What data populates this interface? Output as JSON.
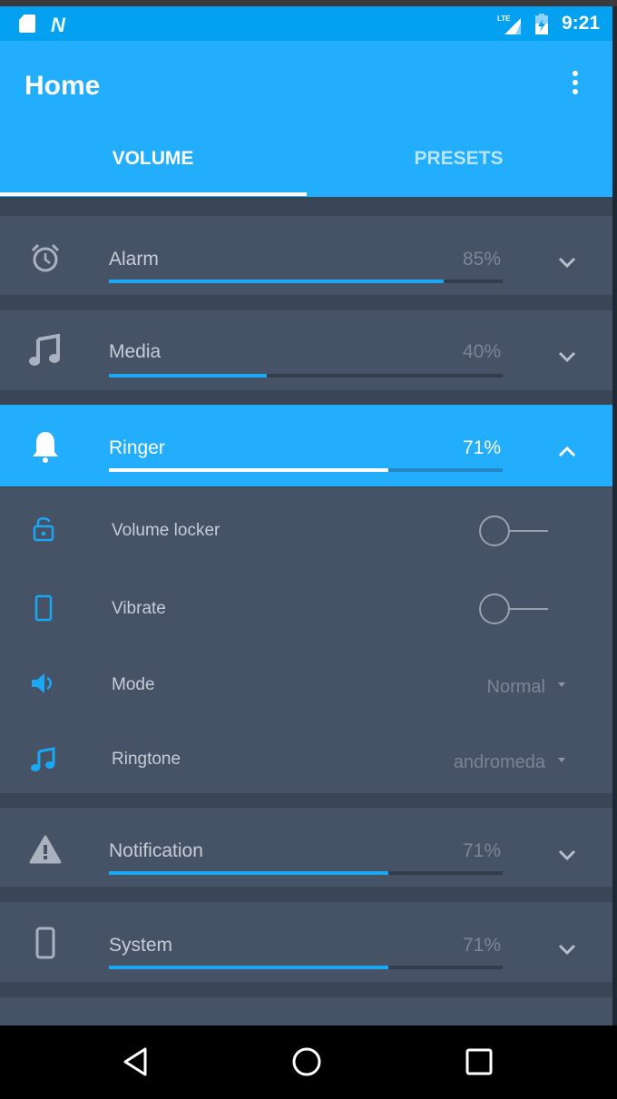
{
  "status_bar": {
    "left_icons": [
      "sd-card-icon",
      "n-notification-icon"
    ],
    "right_icons": [
      "lte-signal-icon",
      "battery-charging-icon"
    ],
    "n_glyph": "N",
    "time": "9:21"
  },
  "app_bar": {
    "title": "Home",
    "menu_icon": "more-vert-icon"
  },
  "tabs": [
    {
      "label": "VOLUME",
      "selected": true
    },
    {
      "label": "PRESETS",
      "selected": false
    }
  ],
  "colors": {
    "status_bar": "#03a1f0",
    "primary": "#23aefd",
    "accent": "#1aa7f4",
    "card": "#465266",
    "background": "#3a4556"
  },
  "volume_streams": [
    {
      "label": "Alarm",
      "percent_text": "85%",
      "level": 0.85,
      "icon": "alarm-clock-icon",
      "expanded": false
    },
    {
      "label": "Media",
      "percent_text": "40%",
      "level": 0.4,
      "icon": "music-note-icon",
      "expanded": false
    },
    {
      "label": "Ringer",
      "percent_text": "71%",
      "level": 0.71,
      "icon": "bell-icon",
      "expanded": true
    },
    {
      "label": "Notification",
      "percent_text": "71%",
      "level": 0.71,
      "icon": "warning-icon",
      "expanded": false
    },
    {
      "label": "System",
      "percent_text": "71%",
      "level": 0.71,
      "icon": "phone-icon",
      "expanded": false
    }
  ],
  "ringer_options": {
    "volume_locker": {
      "label": "Volume locker",
      "on": false,
      "icon": "lock-open-icon"
    },
    "vibrate": {
      "label": "Vibrate",
      "on": false,
      "icon": "vibrate-phone-icon"
    },
    "mode": {
      "label": "Mode",
      "value": "Normal",
      "icon": "speaker-icon"
    },
    "ringtone": {
      "label": "Ringtone",
      "value": "andromeda",
      "icon": "music-note-icon"
    }
  },
  "nav_bar": {
    "buttons": [
      "back-icon",
      "home-icon",
      "recents-icon"
    ]
  }
}
